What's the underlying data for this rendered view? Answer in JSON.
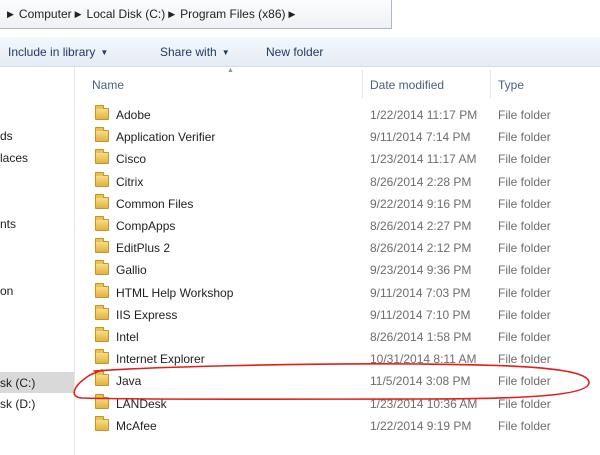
{
  "address_bar": {
    "segments": [
      "Computer",
      "Local Disk (C:)",
      "Program Files (x86)"
    ]
  },
  "toolbar": {
    "include_label": "Include in library",
    "share_label": "Share with",
    "new_folder_label": "New folder"
  },
  "nav": {
    "items": [
      "ds",
      "laces",
      "nts",
      "on",
      "sk (C:)",
      "sk (D:)"
    ]
  },
  "columns": {
    "name": "Name",
    "date": "Date modified",
    "type": "Type"
  },
  "rows": [
    {
      "name": "Adobe",
      "date": "1/22/2014 11:17 PM",
      "type": "File folder"
    },
    {
      "name": "Application Verifier",
      "date": "9/11/2014 7:14 PM",
      "type": "File folder"
    },
    {
      "name": "Cisco",
      "date": "1/23/2014 11:17 AM",
      "type": "File folder"
    },
    {
      "name": "Citrix",
      "date": "8/26/2014 2:28 PM",
      "type": "File folder"
    },
    {
      "name": "Common Files",
      "date": "9/22/2014 9:16 PM",
      "type": "File folder"
    },
    {
      "name": "CompApps",
      "date": "8/26/2014 2:27 PM",
      "type": "File folder"
    },
    {
      "name": "EditPlus 2",
      "date": "8/26/2014 2:12 PM",
      "type": "File folder"
    },
    {
      "name": "Gallio",
      "date": "9/23/2014 9:36 PM",
      "type": "File folder"
    },
    {
      "name": "HTML Help Workshop",
      "date": "9/11/2014 7:03 PM",
      "type": "File folder"
    },
    {
      "name": "IIS Express",
      "date": "9/11/2014 7:10 PM",
      "type": "File folder"
    },
    {
      "name": "Intel",
      "date": "8/26/2014 1:58 PM",
      "type": "File folder"
    },
    {
      "name": "Internet Explorer",
      "date": "10/31/2014 8:11 AM",
      "type": "File folder"
    },
    {
      "name": "Java",
      "date": "11/5/2014 3:08 PM",
      "type": "File folder"
    },
    {
      "name": "LANDesk",
      "date": "1/23/2014 10:36 AM",
      "type": "File folder"
    },
    {
      "name": "McAfee",
      "date": "1/22/2014 9:19 PM",
      "type": "File folder"
    }
  ],
  "colors": {
    "annotation": "#e0201b",
    "folder": "#e9c25a",
    "toolbar_text": "#1e395b"
  }
}
